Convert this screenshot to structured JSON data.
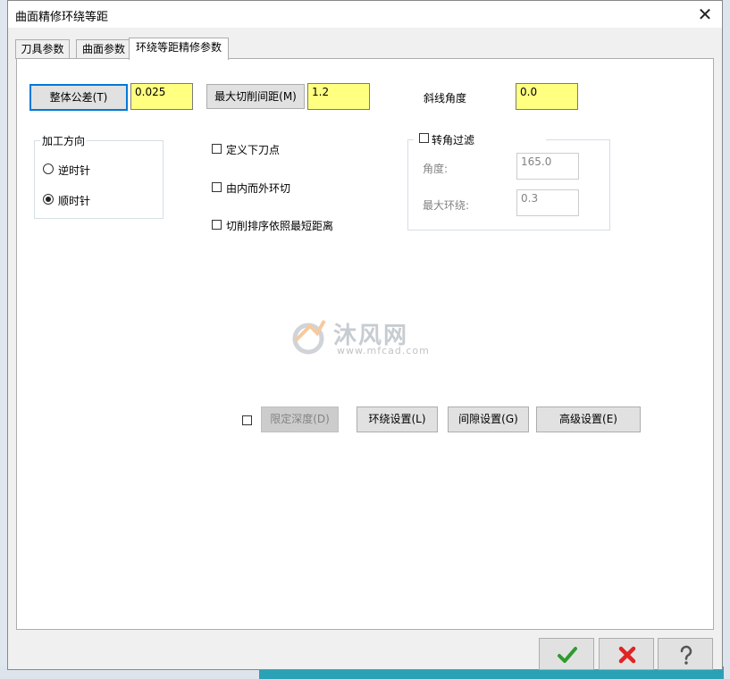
{
  "window": {
    "title": "曲面精修环绕等距",
    "close_icon": "close-icon"
  },
  "tabs": [
    {
      "label": "刀具参数"
    },
    {
      "label": "曲面参数"
    },
    {
      "label": "环绕等距精修参数"
    }
  ],
  "params": {
    "tolerance_label": "整体公差(T)",
    "tolerance_value": "0.025",
    "stepover_label": "最大切削间距(M)",
    "stepover_value": "1.2",
    "slope_label": "斜线角度",
    "slope_value": "0.0"
  },
  "direction": {
    "legend": "加工方向",
    "ccw_label": "逆时针",
    "cw_label": "顺时针",
    "selected": "顺时针"
  },
  "options": {
    "define_entry_label": "定义下刀点",
    "inside_out_label": "由内而外环切",
    "shortest_label": "切削排序依照最短距离"
  },
  "corner_filter": {
    "label": "转角过滤",
    "angle_label": "角度:",
    "angle_value": "165.0",
    "max_loop_label": "最大环绕:",
    "max_loop_value": "0.3"
  },
  "bottom_buttons": {
    "depth_label": "限定深度(D)",
    "loop_settings_label": "环绕设置(L)",
    "gap_settings_label": "间隙设置(G)",
    "advanced_label": "高级设置(E)"
  },
  "watermark": {
    "text": "沐风网",
    "url": "www.mfcad.com"
  },
  "colors": {
    "field_yellow": "#ffff80",
    "ok_green": "#2e9b2e",
    "cancel_red": "#e02424",
    "teal": "#2aa2b6"
  }
}
